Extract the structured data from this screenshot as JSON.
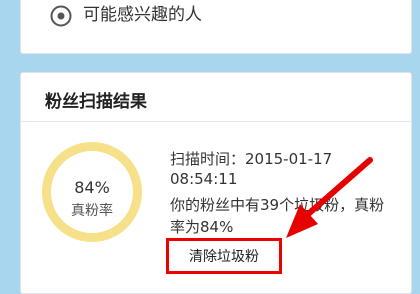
{
  "interest_card": {
    "icon": "eye-icon",
    "label": "可能感兴趣的人"
  },
  "scan_card": {
    "title": "粉丝扫描结果",
    "ring": {
      "percent_text": "84%",
      "label": "真粉率",
      "fraction": 0.84,
      "color": "#f7e08a"
    },
    "scan_time_label": "扫描时间：2015-01-17",
    "scan_time_value": "08:54:11",
    "summary_line1": "你的粉丝中有39个垃圾粉，真粉",
    "summary_line2": "率为84%",
    "clear_button": "清除垃圾粉"
  },
  "colors": {
    "background": "#a9d6ef",
    "highlight": "#ee0000"
  }
}
